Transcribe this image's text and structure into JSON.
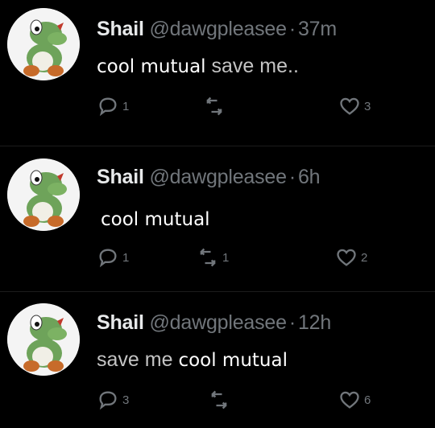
{
  "tweets": [
    {
      "name": "Shail",
      "handle": "@dawgpleasee",
      "separator": "·",
      "time": "37m",
      "text_parts": [
        "cool mutual",
        "save me.."
      ],
      "replies": "1",
      "retweets": "",
      "likes": "3"
    },
    {
      "name": "Shail",
      "handle": "@dawgpleasee",
      "separator": "·",
      "time": "6h",
      "text_parts": [
        "cool mutual"
      ],
      "replies": "1",
      "retweets": "1",
      "likes": "2"
    },
    {
      "name": "Shail",
      "handle": "@dawgpleasee",
      "separator": "·",
      "time": "12h",
      "text_parts": [
        "save me",
        "cool mutual"
      ],
      "replies": "3",
      "retweets": "",
      "likes": "6"
    }
  ],
  "icons": {
    "reply": "reply-icon",
    "retweet": "retweet-icon",
    "like": "heart-icon",
    "avatar": "yoshi-plush-avatar"
  },
  "colors": {
    "background": "#000000",
    "text": "#e7e9ea",
    "muted": "#71767b"
  }
}
